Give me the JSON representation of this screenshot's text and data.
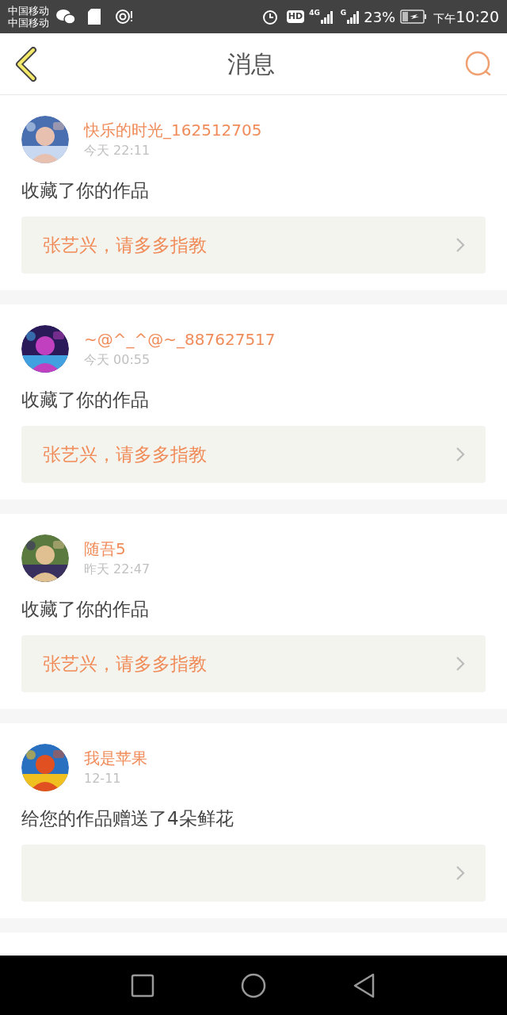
{
  "status_bar": {
    "carriers": [
      "中国移动",
      "中国移动"
    ],
    "hd": "HD",
    "network_1": "4G",
    "network_2": "G",
    "battery": "23%",
    "period": "下午",
    "time": "10:20"
  },
  "header": {
    "title": "消息"
  },
  "messages": [
    {
      "name": "快乐的时光_162512705",
      "time": "今天 22:11",
      "action": "收藏了你的作品",
      "work": "张艺兴，请多多指教"
    },
    {
      "name": "~@^_^@~_887627517",
      "time": "今天 00:55",
      "action": "收藏了你的作品",
      "work": "张艺兴，请多多指教"
    },
    {
      "name": "随吾5",
      "time": "昨天 22:47",
      "action": "收藏了你的作品",
      "work": "张艺兴，请多多指教"
    },
    {
      "name": "我是苹果",
      "time": "12-11",
      "action": "给您的作品赠送了4朵鲜花"
    }
  ]
}
